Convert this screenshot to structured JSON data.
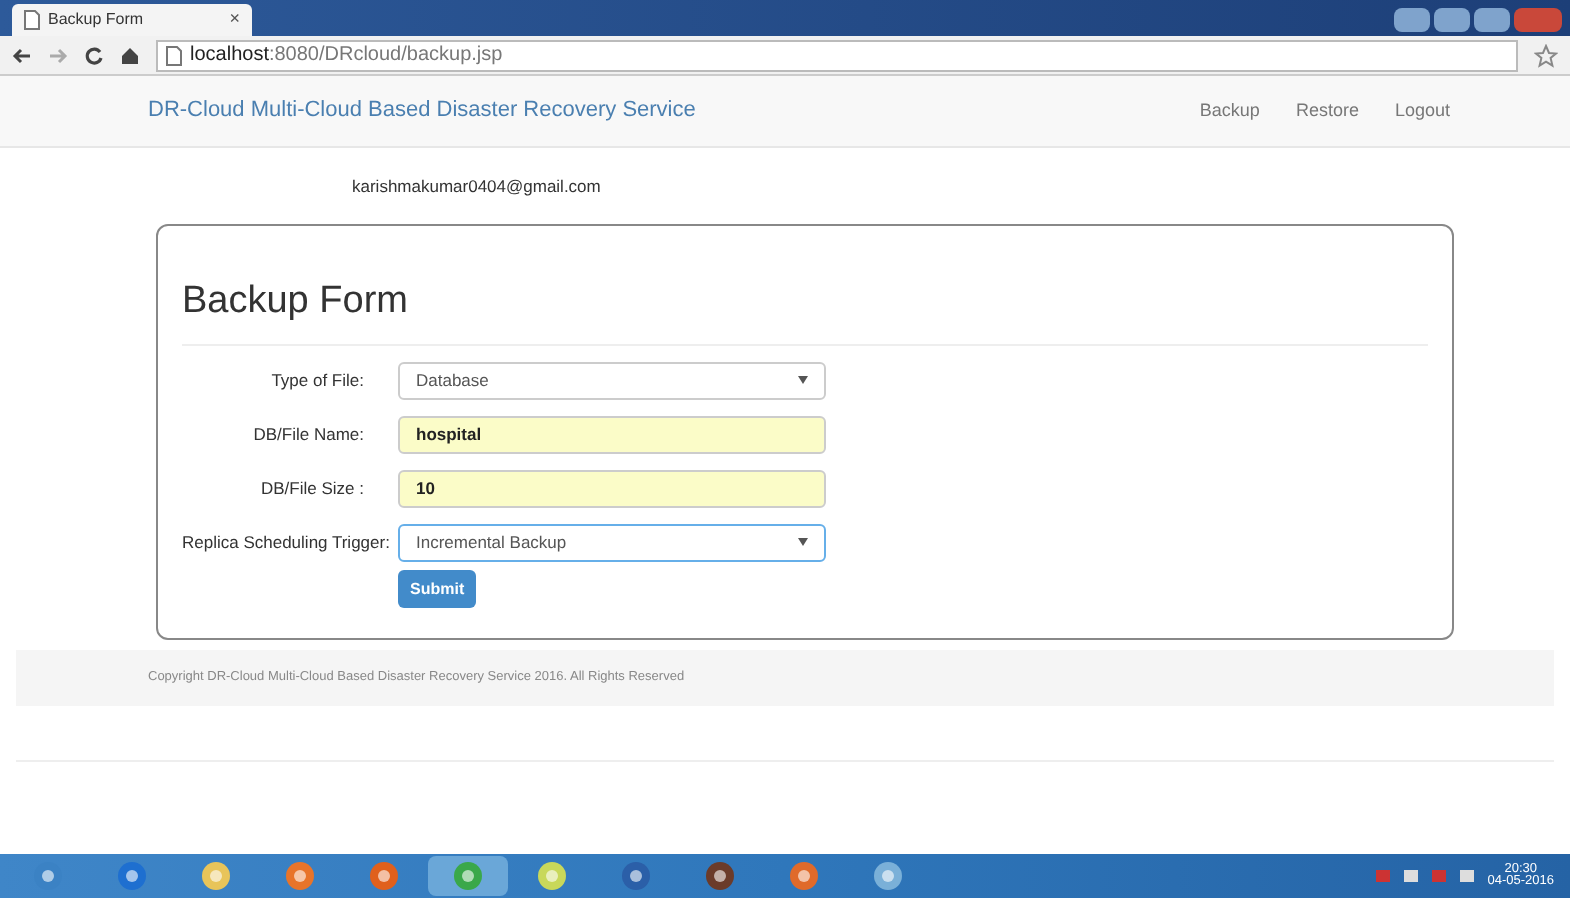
{
  "browser": {
    "tab_title": "Backup Form",
    "tab_close": "×",
    "url_host": "localhost",
    "url_rest": ":8080/DRcloud/backup.jsp"
  },
  "navbar": {
    "brand": "DR-Cloud Multi-Cloud Based Disaster Recovery Service",
    "links": [
      "Backup",
      "Restore",
      "Logout"
    ]
  },
  "user_email": "karishmakumar0404@gmail.com",
  "form": {
    "title": "Backup Form",
    "fields": [
      {
        "label": "Type of File:",
        "kind": "select",
        "value": "Database",
        "autofilled": false,
        "focused": false
      },
      {
        "label": "DB/File Name:",
        "kind": "text",
        "value": "hospital",
        "autofilled": true,
        "focused": false
      },
      {
        "label": "DB/File Size :",
        "kind": "text",
        "value": "10",
        "autofilled": true,
        "focused": false
      },
      {
        "label": "Replica Scheduling Trigger:",
        "kind": "select",
        "value": "Incremental Backup",
        "autofilled": false,
        "focused": true
      }
    ],
    "submit": "Submit"
  },
  "footer": "Copyright DR-Cloud Multi-Cloud Based Disaster Recovery Service 2016. All Rights Reserved",
  "taskbar": {
    "time": "20:30",
    "date": "04-05-2016"
  }
}
